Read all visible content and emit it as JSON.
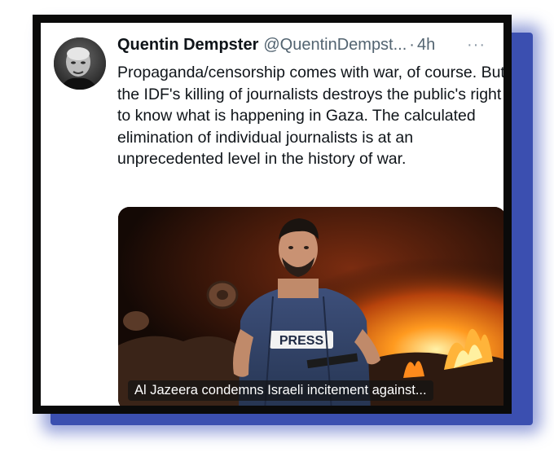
{
  "tweet": {
    "author_name": "Quentin Dempster",
    "author_handle": "@QuentinDempst...",
    "separator": "·",
    "time": "4h",
    "more_label": "···",
    "text": "Propaganda/censorship comes with war, of course. But the IDF's killing of journalists destroys the public's right to know what is happening in Gaza. The calculated elimination of individual journalists is at an unprecedented level in the history of war."
  },
  "media": {
    "vest_label": "PRESS",
    "caption": "Al Jazeera condemns Israeli incitement against..."
  },
  "icons": {
    "more": "more-options-icon",
    "avatar": "author-avatar"
  },
  "colors": {
    "text": "#0f1419",
    "muted": "#536471",
    "frame": "#0a0a0a",
    "shadow": "#3b4fb0"
  }
}
